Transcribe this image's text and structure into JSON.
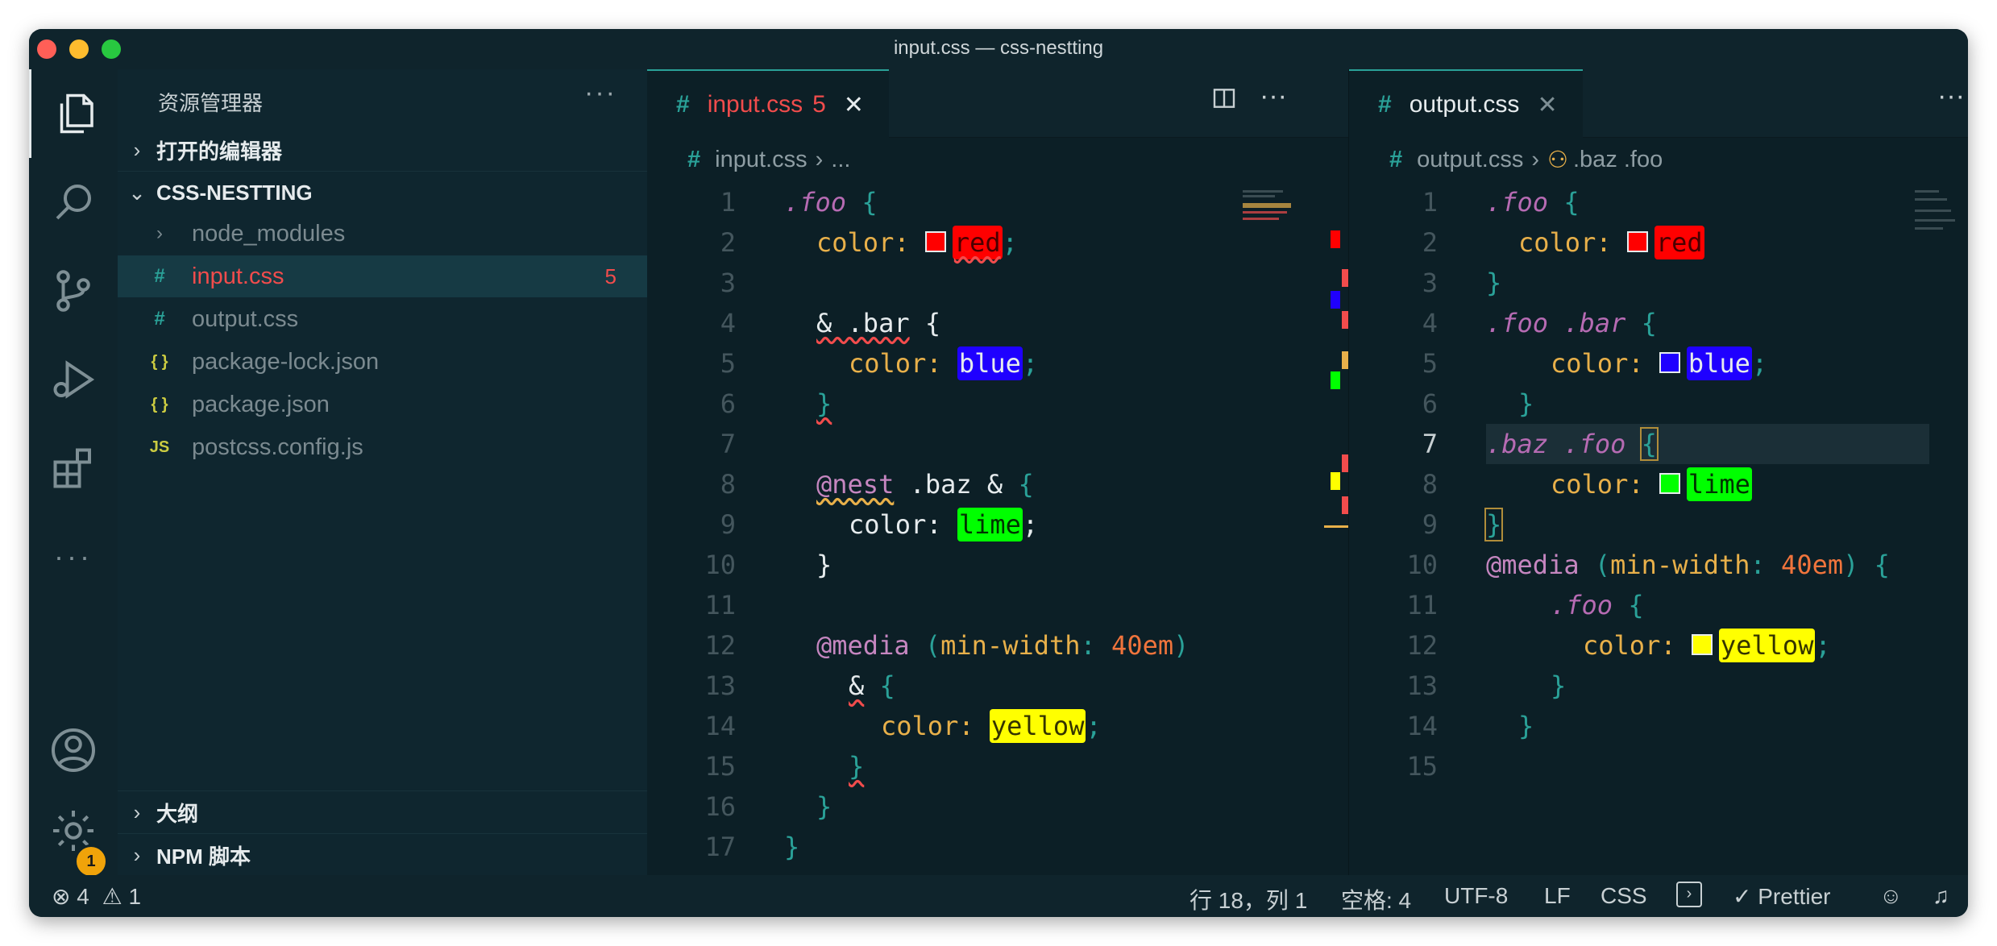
{
  "window": {
    "title": "input.css — css-nestting"
  },
  "activity_bar": {
    "items": [
      "explorer-icon",
      "search-icon",
      "source-control-icon",
      "run-debug-icon",
      "extensions-icon",
      "more-icon",
      "account-icon",
      "manage-gear-icon"
    ],
    "manage_badge": "1"
  },
  "sidebar": {
    "title": "资源管理器",
    "more": "···",
    "open_editors": "打开的编辑器",
    "project": "CSS-NESTTING",
    "files": [
      {
        "icon": "#",
        "name": "node_modules",
        "type": "folder"
      },
      {
        "icon": "#",
        "name": "input.css",
        "count": "5"
      },
      {
        "icon": "#",
        "name": "output.css"
      },
      {
        "icon": "{ }",
        "name": "package-lock.json"
      },
      {
        "icon": "{ }",
        "name": "package.json"
      },
      {
        "icon": "JS",
        "name": "postcss.config.js"
      }
    ],
    "outline": "大纲",
    "npm_scripts": "NPM 脚本"
  },
  "left_editor": {
    "tab_label": "input.css",
    "tab_errors": "5",
    "breadcrumb_file": "input.css",
    "breadcrumb_rest": "...",
    "line_numbers": [
      "1",
      "2",
      "3",
      "4",
      "5",
      "6",
      "7",
      "8",
      "9",
      "10",
      "11",
      "12",
      "13",
      "14",
      "15",
      "16",
      "17"
    ]
  },
  "right_editor": {
    "tab_label": "output.css",
    "breadcrumb_file": "output.css",
    "breadcrumb_symbol": ".baz .foo",
    "line_numbers": [
      "1",
      "2",
      "3",
      "4",
      "5",
      "6",
      "7",
      "8",
      "9",
      "10",
      "11",
      "12",
      "13",
      "14",
      "15"
    ],
    "current_line": "7"
  },
  "colors": {
    "red": "#ff0000",
    "blue": "#1f00ff",
    "lime": "#00ff00",
    "yellow": "#ffff00",
    "accent": "#2aa198",
    "error": "#f14c4c"
  },
  "code_text": {
    "foo": ".foo",
    "color": "color:",
    "red": "red",
    "blue": "blue",
    "lime": "lime",
    "yellow": "yellow",
    "amp_bar": "& .bar",
    "nest": "@nest",
    "baz_amp": " .baz & ",
    "media": "@media",
    "min_width": "min-width",
    "em": "40em",
    "foo_bar": ".foo .bar",
    "baz_foo": ".baz .foo"
  },
  "status_bar": {
    "errors": "4",
    "warnings": "1",
    "position": "行 18，列 1",
    "spaces": "空格: 4",
    "encoding": "UTF-8",
    "eol": "LF",
    "language": "CSS",
    "prettier": "Prettier"
  }
}
